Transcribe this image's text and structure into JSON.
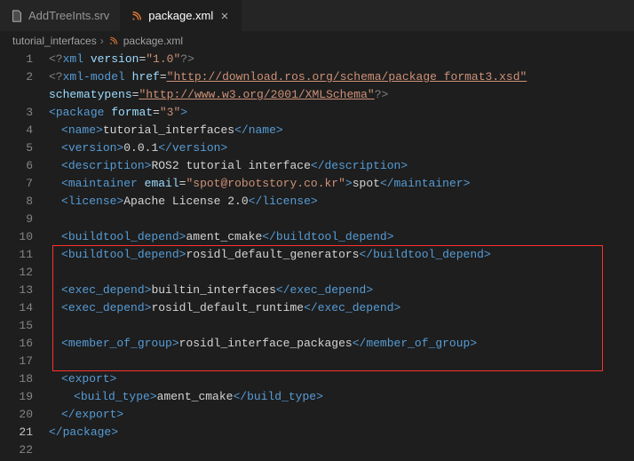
{
  "tabs": [
    {
      "label": "AddTreeInts.srv",
      "active": false,
      "icon": "file-icon"
    },
    {
      "label": "package.xml",
      "active": true,
      "icon": "xml-icon"
    }
  ],
  "breadcrumbs": {
    "root": "tutorial_interfaces",
    "file": "package.xml",
    "file_icon": "xml-icon"
  },
  "line_count": 22,
  "current_line": 21,
  "highlight": {
    "from_line": 11,
    "to_line": 17
  },
  "xml": {
    "pi_start": "<?",
    "pi_end": "?>",
    "xml_kw": "xml",
    "version_attr": "version",
    "version_val": "\"1.0\"",
    "model_kw": "xml-model",
    "href_attr": "href",
    "href_val": "\"http://download.ros.org/schema/package_format3.xsd\"",
    "schematypens_attr": "schematypens",
    "schematypens_val": "\"http://www.w3.org/2001/XMLSchema\"",
    "open_lt": "<",
    "close_lt": "</",
    "gt": ">",
    "selfclose": "/>",
    "package_tag": "package",
    "format_attr": "format",
    "format_val": "\"3\"",
    "name_tag": "name",
    "name_txt": "tutorial_interfaces",
    "version_tag": "version",
    "version_txt": "0.0.1",
    "description_tag": "description",
    "description_txt": "ROS2 tutorial interface",
    "maintainer_tag": "maintainer",
    "email_attr": "email",
    "email_val": "\"spot@robotstory.co.kr\"",
    "maintainer_txt": "spot",
    "license_tag": "license",
    "license_txt": "Apache License 2.0",
    "buildtool_tag": "buildtool_depend",
    "buildtool_txt_1": "ament_cmake",
    "buildtool_txt_2": "rosidl_default_generators",
    "exec_depend_tag": "exec_depend",
    "exec_txt_1": "builtin_interfaces",
    "exec_txt_2": "rosidl_default_runtime",
    "member_tag": "member_of_group",
    "member_txt": "rosidl_interface_packages",
    "export_tag": "export",
    "build_type_tag": "build_type",
    "build_type_txt": "ament_cmake"
  }
}
